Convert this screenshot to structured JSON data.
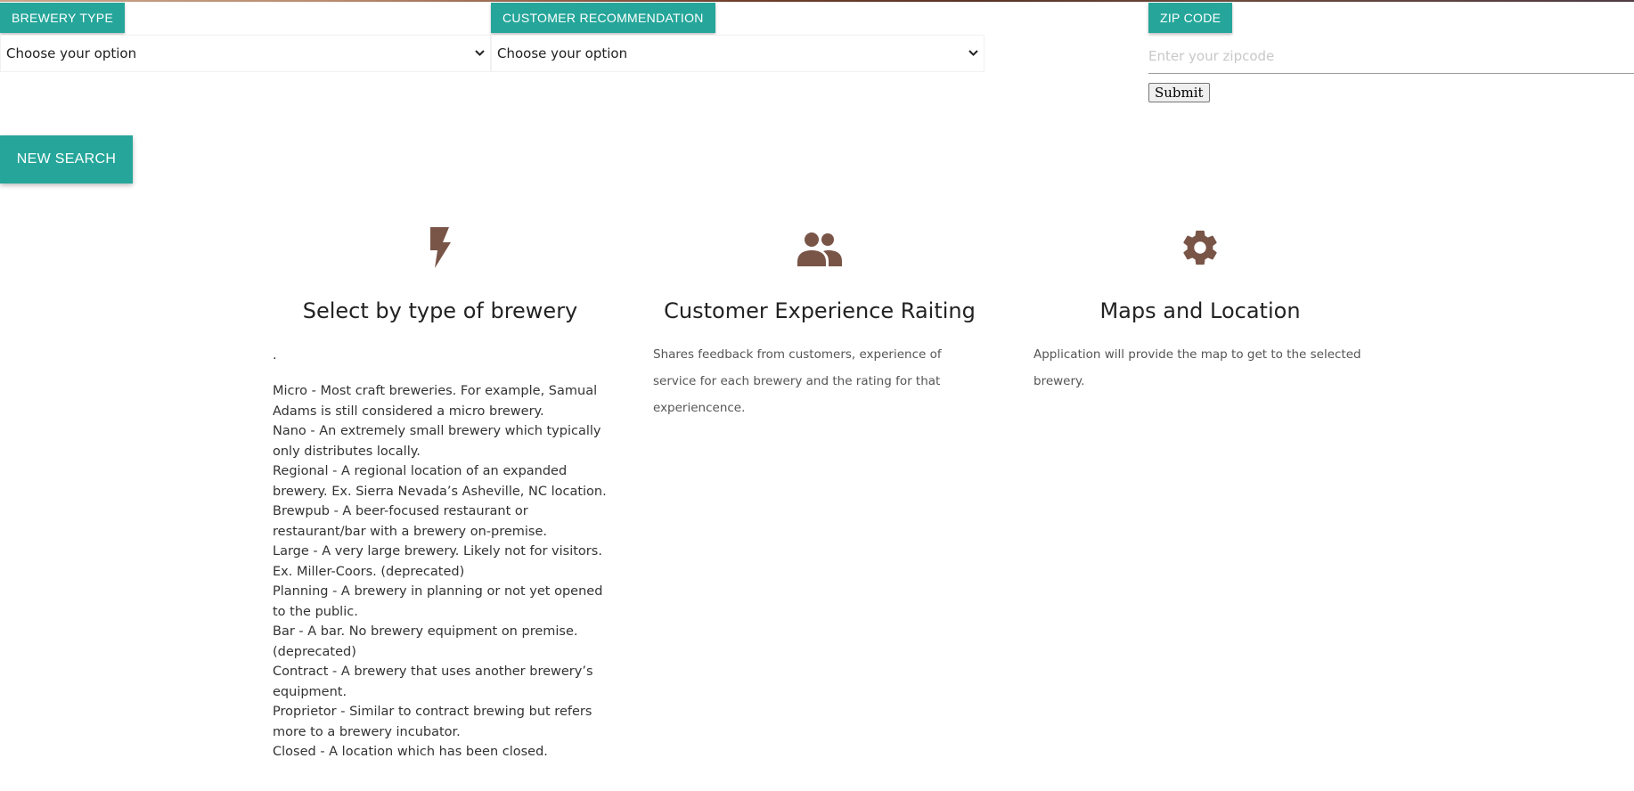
{
  "filters": {
    "brewery_type": {
      "label": "BREWERY TYPE",
      "selected": "Choose your option",
      "icon": "chevron-down-icon"
    },
    "customer_recommendation": {
      "label": "CUSTOMER RECOMMENDATION",
      "selected": "Choose your option",
      "icon": "chevron-down-icon"
    },
    "zip_code": {
      "label": "ZIP CODE",
      "placeholder": "Enter your zipcode",
      "value": "",
      "submit_label": "Submit"
    }
  },
  "new_search_label": "NEW SEARCH",
  "colors": {
    "accent": "#26a69a",
    "icon": "#795548"
  },
  "features": [
    {
      "icon": "flash-icon",
      "title": "Select by type of brewery",
      "intro": ".",
      "types": [
        "Micro - Most craft breweries. For example, Samual Adams is still considered a micro brewery.",
        "Nano - An extremely small brewery which typically only distributes locally.",
        "Regional - A regional location of an expanded brewery. Ex. Sierra Nevada’s Asheville, NC location.",
        "Brewpub - A beer-focused restaurant or restaurant/bar with a brewery on-premise.",
        "Large - A very large brewery. Likely not for visitors. Ex. Miller-Coors. (deprecated)",
        "Planning - A brewery in planning or not yet opened to the public.",
        "Bar - A bar. No brewery equipment on premise. (deprecated)",
        "Contract - A brewery that uses another brewery’s equipment.",
        "Proprietor - Similar to contract brewing but refers more to a brewery incubator.",
        "Closed - A location which has been closed."
      ]
    },
    {
      "icon": "group-icon",
      "title": "Customer Experience Raiting",
      "description": "Shares feedback from customers, experience of service for each brewery and the rating for that experiencence."
    },
    {
      "icon": "gear-icon",
      "title": "Maps and Location",
      "description": "Application will provide the map to get to the selected brewery."
    }
  ]
}
